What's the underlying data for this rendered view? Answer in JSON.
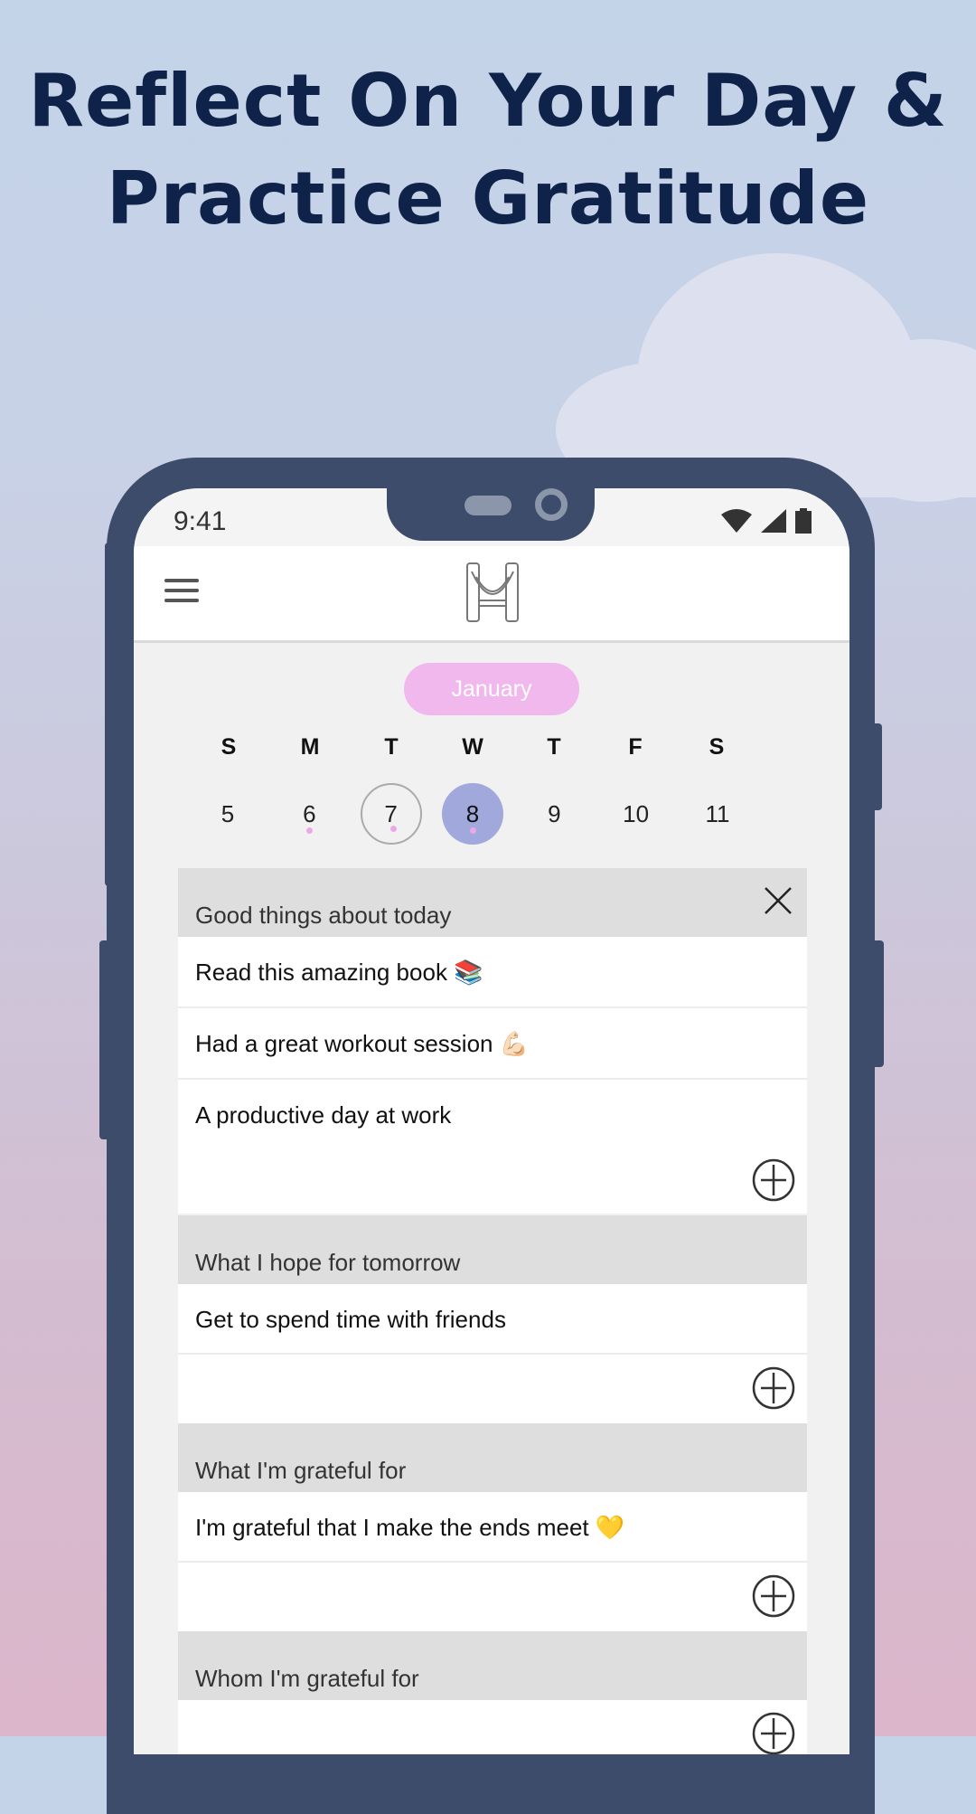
{
  "headline": {
    "line1": "Reflect On Your Day &",
    "line2": "Practice Gratitude"
  },
  "status_bar": {
    "time": "9:41",
    "icons": [
      "wifi-icon",
      "signal-icon",
      "battery-icon"
    ]
  },
  "app_bar": {
    "menu_icon": "hamburger-menu-icon",
    "logo": "app-logo"
  },
  "calendar": {
    "month": "January",
    "weekdays": [
      "S",
      "M",
      "T",
      "W",
      "T",
      "F",
      "S"
    ],
    "days": [
      {
        "label": "5",
        "state": "normal",
        "has_entry": false
      },
      {
        "label": "6",
        "state": "normal",
        "has_entry": true
      },
      {
        "label": "7",
        "state": "outlined",
        "has_entry": true
      },
      {
        "label": "8",
        "state": "selected",
        "has_entry": true
      },
      {
        "label": "9",
        "state": "normal",
        "has_entry": false
      },
      {
        "label": "10",
        "state": "normal",
        "has_entry": false
      },
      {
        "label": "11",
        "state": "normal",
        "has_entry": false
      }
    ]
  },
  "sections": [
    {
      "title": "Good things about today",
      "entries": [
        "Read this amazing book 📚",
        "Had a great workout session 💪🏻",
        "A productive day at work"
      ]
    },
    {
      "title": "What I hope for tomorrow",
      "entries": [
        "Get to spend time with friends"
      ]
    },
    {
      "title": "What I'm grateful for",
      "entries": [
        "I'm grateful that I make the ends meet 💛"
      ]
    },
    {
      "title": "Whom I'm grateful for",
      "entries": []
    }
  ],
  "colors": {
    "headline": "#0f2249",
    "phone_frame": "#3d4c6a",
    "month_pill": "#f1b8ee",
    "selected_day": "#a1a8db",
    "entry_dot": "#eda7e5",
    "section_header": "#dedede"
  }
}
